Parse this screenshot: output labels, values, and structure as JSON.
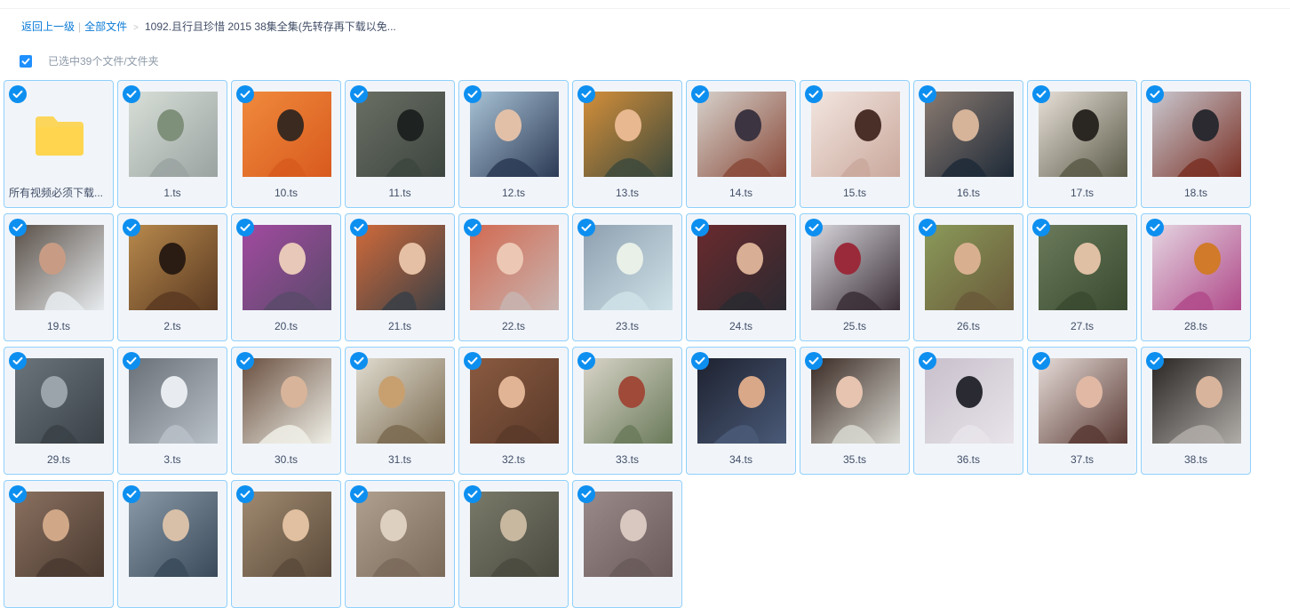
{
  "breadcrumb": {
    "back_label": "返回上一级",
    "separator": "|",
    "root_label": "全部文件",
    "arrow": ">",
    "current_label": "1092.且行且珍惜 2015 38集全集(先转存再下载以免..."
  },
  "selection": {
    "text": "已选中39个文件/文件夹"
  },
  "colors": {
    "accent": "#0d8ff0",
    "tile_border": "#90d0fb",
    "tile_bg": "#f1f5fa",
    "folder": "#fcd65a"
  },
  "files": [
    {
      "name": "所有视频必须下载...",
      "type": "folder",
      "icon": "folder-icon"
    },
    {
      "name": "1.ts",
      "type": "video",
      "palette": [
        "#9aa3a1",
        "#d8dfd8",
        "#7e8f7a"
      ]
    },
    {
      "name": "10.ts",
      "type": "video",
      "palette": [
        "#d85a1e",
        "#f08a3c",
        "#3b2a20"
      ]
    },
    {
      "name": "11.ts",
      "type": "video",
      "palette": [
        "#3d4540",
        "#6a6f63",
        "#1e2220"
      ]
    },
    {
      "name": "12.ts",
      "type": "video",
      "palette": [
        "#2c3a55",
        "#a9c3d6",
        "#e2c0a8"
      ]
    },
    {
      "name": "13.ts",
      "type": "video",
      "palette": [
        "#3e4a3c",
        "#d48f3a",
        "#e8b890"
      ]
    },
    {
      "name": "14.ts",
      "type": "video",
      "palette": [
        "#8a4a3a",
        "#d6d2cc",
        "#3c3440"
      ]
    },
    {
      "name": "15.ts",
      "type": "video",
      "palette": [
        "#caa89c",
        "#f2e6e0",
        "#4a2e28"
      ]
    },
    {
      "name": "16.ts",
      "type": "video",
      "palette": [
        "#1e2a38",
        "#8a7a70",
        "#d6b49a"
      ]
    },
    {
      "name": "17.ts",
      "type": "video",
      "palette": [
        "#5a5a48",
        "#e8e0d8",
        "#2a2622"
      ]
    },
    {
      "name": "18.ts",
      "type": "video",
      "palette": [
        "#7a3024",
        "#c9c8d0",
        "#2a2a30"
      ]
    },
    {
      "name": "19.ts",
      "type": "video",
      "palette": [
        "#e8ecef",
        "#5a5048",
        "#c89c84"
      ]
    },
    {
      "name": "2.ts",
      "type": "video",
      "palette": [
        "#5a3a22",
        "#b8894c",
        "#2a1c12"
      ]
    },
    {
      "name": "20.ts",
      "type": "video",
      "palette": [
        "#5a4a6a",
        "#a24aa0",
        "#e8c8b8"
      ]
    },
    {
      "name": "21.ts",
      "type": "video",
      "palette": [
        "#3a4046",
        "#d06a3a",
        "#e6c0a4"
      ]
    },
    {
      "name": "22.ts",
      "type": "video",
      "palette": [
        "#c8b4b0",
        "#d26a52",
        "#ecc8b4"
      ]
    },
    {
      "name": "23.ts",
      "type": "video",
      "palette": [
        "#cfe2e8",
        "#8ea0b0",
        "#e8f0e8"
      ]
    },
    {
      "name": "24.ts",
      "type": "video",
      "palette": [
        "#2a2a30",
        "#6a2a2e",
        "#d8ae94"
      ]
    },
    {
      "name": "25.ts",
      "type": "video",
      "palette": [
        "#3a2e36",
        "#d8d6dc",
        "#9a2a3a"
      ]
    },
    {
      "name": "26.ts",
      "type": "video",
      "palette": [
        "#6a5a3a",
        "#8a9a5a",
        "#d8b090"
      ]
    },
    {
      "name": "27.ts",
      "type": "video",
      "palette": [
        "#3a4a30",
        "#6a7a5a",
        "#e0c0a4"
      ]
    },
    {
      "name": "28.ts",
      "type": "video",
      "palette": [
        "#b04a8a",
        "#e4d4e0",
        "#d07a2a"
      ]
    },
    {
      "name": "29.ts",
      "type": "video",
      "palette": [
        "#3a4248",
        "#6a747a",
        "#9aa4aa"
      ]
    },
    {
      "name": "3.ts",
      "type": "video",
      "palette": [
        "#b8c0c8",
        "#6a7078",
        "#e8ecf0"
      ]
    },
    {
      "name": "30.ts",
      "type": "video",
      "palette": [
        "#f0f0e8",
        "#6a5040",
        "#d8b49a"
      ]
    },
    {
      "name": "31.ts",
      "type": "video",
      "palette": [
        "#7a6a50",
        "#e0dcd0",
        "#c8a070"
      ]
    },
    {
      "name": "32.ts",
      "type": "video",
      "palette": [
        "#5a3a2a",
        "#8a5a40",
        "#e0b494"
      ]
    },
    {
      "name": "33.ts",
      "type": "video",
      "palette": [
        "#6a7a5a",
        "#d8d4c8",
        "#a04a3a"
      ]
    },
    {
      "name": "34.ts",
      "type": "video",
      "palette": [
        "#4a5a78",
        "#1e2230",
        "#d8a888"
      ]
    },
    {
      "name": "35.ts",
      "type": "video",
      "palette": [
        "#d8d8d0",
        "#3a2a24",
        "#e6c4b0"
      ]
    },
    {
      "name": "36.ts",
      "type": "video",
      "palette": [
        "#e8e4ea",
        "#c8c0cc",
        "#2a2a32"
      ]
    },
    {
      "name": "37.ts",
      "type": "video",
      "palette": [
        "#5a3a34",
        "#e6dcd8",
        "#e0b8a4"
      ]
    },
    {
      "name": "38.ts",
      "type": "video",
      "palette": [
        "#b0aca8",
        "#2a2624",
        "#d8b49c"
      ]
    },
    {
      "name": "",
      "type": "video",
      "palette": [
        "#4a3a30",
        "#8a7060",
        "#d0a888"
      ]
    },
    {
      "name": "",
      "type": "video",
      "palette": [
        "#3a4a5a",
        "#8a9aa8",
        "#d8c0a8"
      ]
    },
    {
      "name": "",
      "type": "video",
      "palette": [
        "#5a4a3a",
        "#a08a70",
        "#e0c0a0"
      ]
    },
    {
      "name": "",
      "type": "video",
      "palette": [
        "#7a6a5a",
        "#b0a090",
        "#ddd0c0"
      ]
    },
    {
      "name": "",
      "type": "video",
      "palette": [
        "#4a4a40",
        "#7a7a6a",
        "#c8b8a0"
      ]
    },
    {
      "name": "",
      "type": "video",
      "palette": [
        "#6a5a5a",
        "#9a8a8a",
        "#d8c8c0"
      ]
    }
  ]
}
